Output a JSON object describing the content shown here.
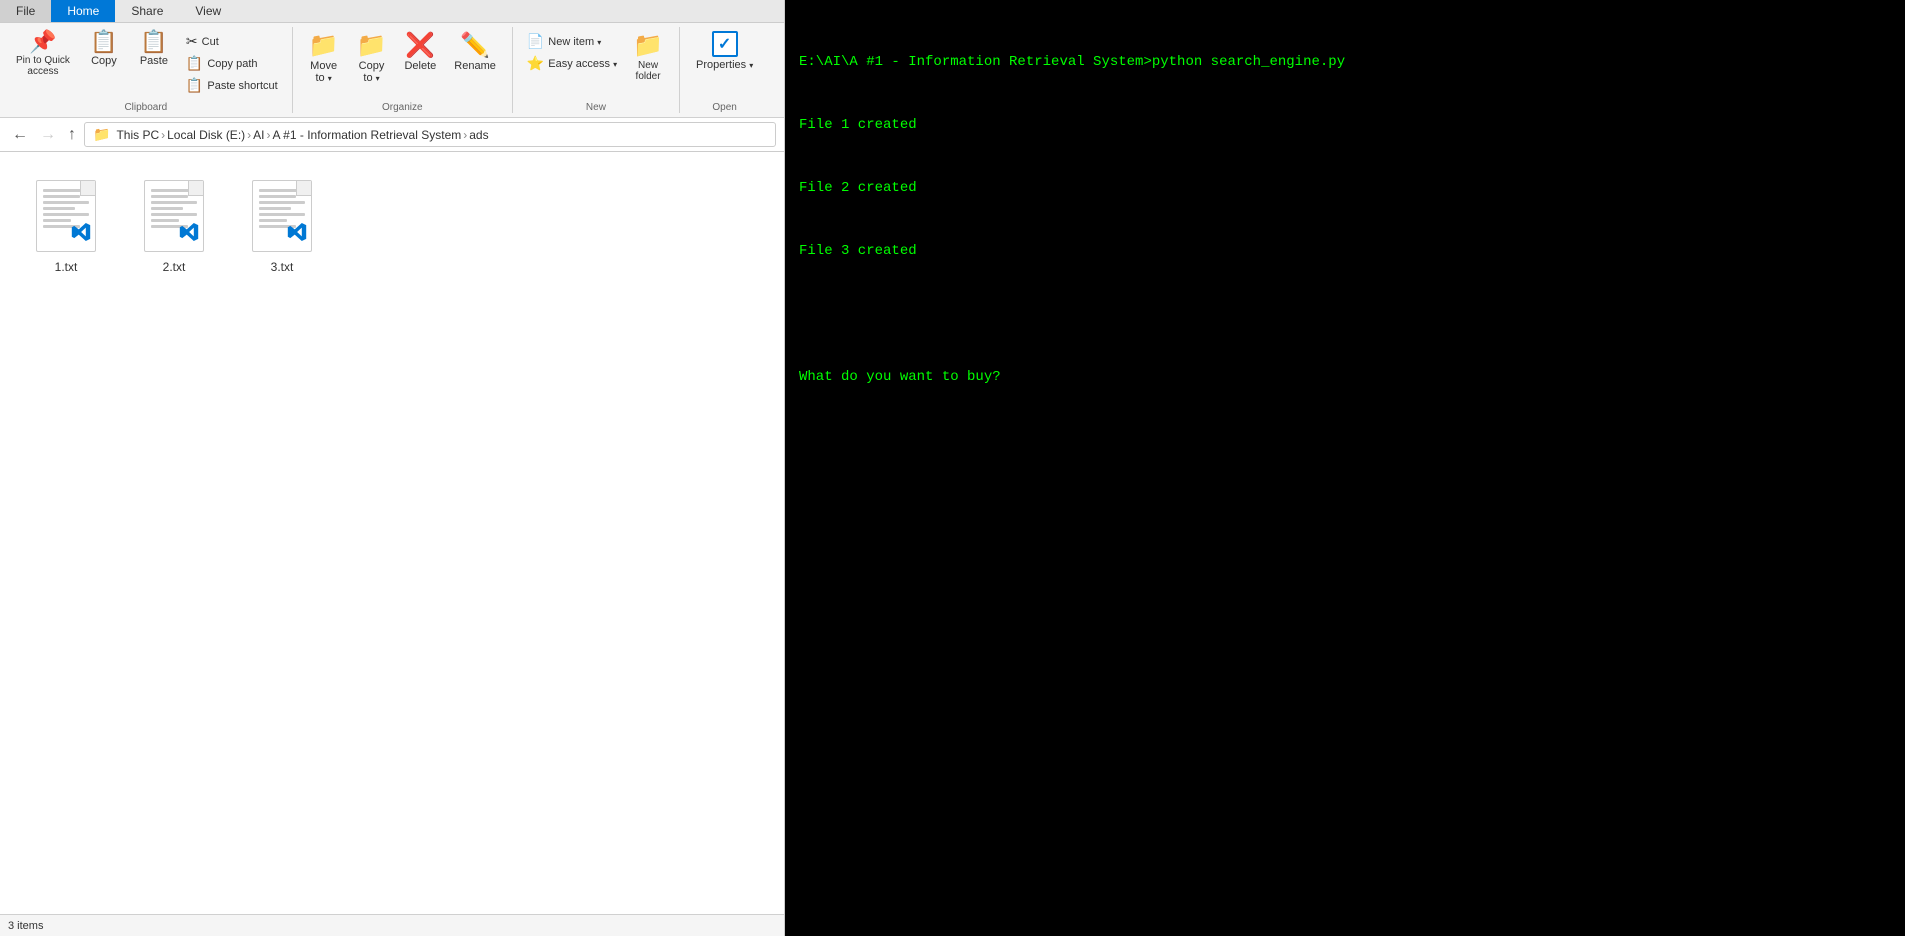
{
  "ribbon": {
    "tabs": [
      {
        "id": "file",
        "label": "File"
      },
      {
        "id": "home",
        "label": "Home",
        "active": true
      },
      {
        "id": "share",
        "label": "Share"
      },
      {
        "id": "view",
        "label": "View"
      }
    ],
    "groups": {
      "clipboard": {
        "label": "Clipboard",
        "buttons": {
          "pin": "Pin to Quick\naccess",
          "copy": "Copy",
          "paste": "Paste",
          "cut": "Cut",
          "copy_path": "Copy path",
          "paste_shortcut": "Paste shortcut"
        }
      },
      "organize": {
        "label": "Organize",
        "buttons": {
          "move_to": "Move\nto",
          "copy_to": "Copy\nto",
          "delete": "Delete",
          "rename": "Rename"
        }
      },
      "new": {
        "label": "New",
        "buttons": {
          "new_item": "New item",
          "easy_access": "Easy\naccess",
          "new_folder": "New\nfolder"
        }
      },
      "open": {
        "label": "Open",
        "buttons": {
          "properties": "Properties"
        }
      }
    }
  },
  "breadcrumb": {
    "parts": [
      "This PC",
      "Local Disk (E:)",
      "AI",
      "A #1 - Information Retrieval System",
      "ads"
    ]
  },
  "files": [
    {
      "name": "1.txt",
      "type": "txt"
    },
    {
      "name": "2.txt",
      "type": "txt"
    },
    {
      "name": "3.txt",
      "type": "txt"
    }
  ],
  "terminal": {
    "lines": [
      "E:\\AI\\A #1 - Information Retrieval System>python search_engine.py",
      "File 1 created",
      "File 2 created",
      "File 3 created",
      "",
      "What do you want to buy?"
    ]
  }
}
